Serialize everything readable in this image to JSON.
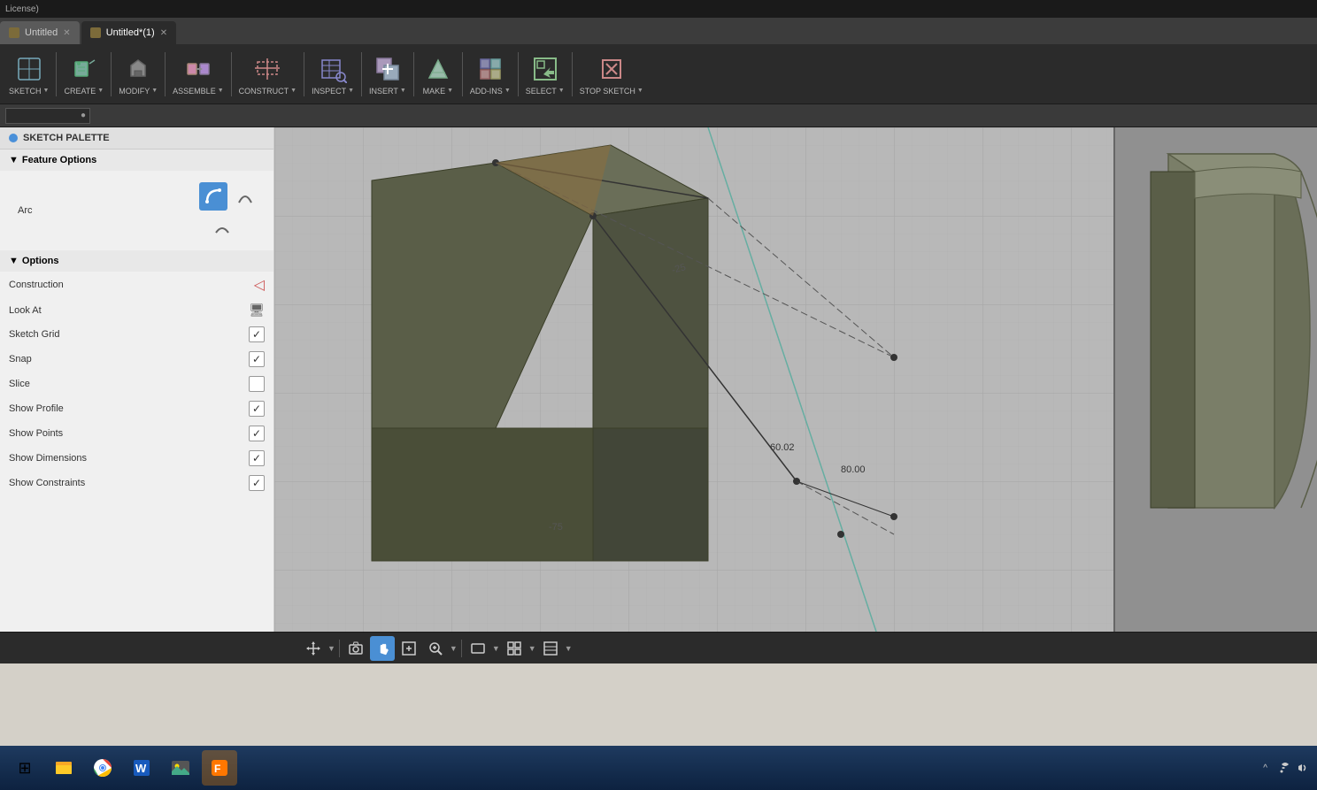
{
  "titlebar": {
    "text": "License)"
  },
  "tabs": [
    {
      "id": "tab1",
      "label": "Untitled",
      "active": false
    },
    {
      "id": "tab2",
      "label": "Untitled*(1)",
      "active": true
    }
  ],
  "toolbar": {
    "groups": [
      {
        "id": "sketch",
        "label": "SKETCH",
        "arrow": true
      },
      {
        "id": "create",
        "label": "CREATE",
        "arrow": true
      },
      {
        "id": "modify",
        "label": "MODIFY",
        "arrow": true
      },
      {
        "id": "assemble",
        "label": "ASSEMBLE",
        "arrow": true
      },
      {
        "id": "construct",
        "label": "CONSTRUCT",
        "arrow": true
      },
      {
        "id": "inspect",
        "label": "INSPECT",
        "arrow": true
      },
      {
        "id": "insert",
        "label": "INSERT",
        "arrow": true
      },
      {
        "id": "make",
        "label": "MAKE",
        "arrow": true
      },
      {
        "id": "addins",
        "label": "ADD-INS",
        "arrow": true
      },
      {
        "id": "select",
        "label": "SELECT",
        "arrow": true
      },
      {
        "id": "stopsketch",
        "label": "STOP SKETCH",
        "arrow": true
      }
    ]
  },
  "sketchPalette": {
    "title": "SKETCH PALETTE",
    "sections": [
      {
        "id": "feature-options",
        "label": "Feature Options",
        "expanded": true
      },
      {
        "id": "options",
        "label": "Options",
        "expanded": true
      }
    ],
    "featureOptions": {
      "label": "Arc"
    },
    "options": [
      {
        "id": "construction",
        "label": "Construction",
        "type": "icon",
        "checked": false
      },
      {
        "id": "look-at",
        "label": "Look At",
        "type": "icon",
        "checked": false
      },
      {
        "id": "sketch-grid",
        "label": "Sketch Grid",
        "type": "checkbox",
        "checked": true
      },
      {
        "id": "snap",
        "label": "Snap",
        "type": "checkbox",
        "checked": true
      },
      {
        "id": "slice",
        "label": "Slice",
        "type": "checkbox",
        "checked": false
      },
      {
        "id": "show-profile",
        "label": "Show Profile",
        "type": "checkbox",
        "checked": true
      },
      {
        "id": "show-points",
        "label": "Show Points",
        "type": "checkbox",
        "checked": true
      },
      {
        "id": "show-dimensions",
        "label": "Show Dimensions",
        "type": "checkbox",
        "checked": true
      },
      {
        "id": "show-constraints",
        "label": "Show Constraints",
        "type": "checkbox",
        "checked": true
      }
    ]
  },
  "bottomToolbar": {
    "tools": [
      {
        "id": "move",
        "icon": "⊕",
        "active": false
      },
      {
        "id": "camera",
        "icon": "📷",
        "active": false
      },
      {
        "id": "hand",
        "icon": "✋",
        "active": true
      },
      {
        "id": "zoom-fit",
        "icon": "⊡",
        "active": false
      },
      {
        "id": "zoom-menu",
        "icon": "🔍",
        "active": false
      },
      {
        "id": "display",
        "icon": "◻",
        "active": false
      },
      {
        "id": "grid",
        "icon": "⊞",
        "active": false
      },
      {
        "id": "grid2",
        "icon": "⊟",
        "active": false
      }
    ]
  },
  "taskbar": {
    "apps": [
      {
        "id": "explorer",
        "icon": "🗂"
      },
      {
        "id": "chrome",
        "icon": "🌐"
      },
      {
        "id": "word",
        "icon": "W"
      },
      {
        "id": "photos",
        "icon": "🖼"
      },
      {
        "id": "fusion",
        "icon": "F"
      }
    ]
  },
  "canvas": {
    "dimension1": "80.00",
    "dimension2": "60.02"
  },
  "colors": {
    "accent_blue": "#4a8fd4",
    "toolbar_bg": "#2b2b2b",
    "panel_bg": "#f0f0f0",
    "canvas_bg": "#bebebe",
    "taskbar_bg": "#0d2240"
  }
}
